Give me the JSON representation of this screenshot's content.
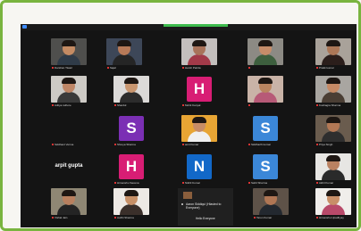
{
  "tiles": {
    "r0": [
      {
        "name": "Darshan Tiwari",
        "type": "video",
        "bg": "#4f4f4d",
        "skin": "#c48b63",
        "shirt": "#2f3b48"
      },
      {
        "name": "Sajal",
        "type": "video",
        "bg": "#3d4758",
        "skin": "#b77a58",
        "shirt": "#252525"
      },
      {
        "name": "Harsh Parida",
        "type": "video",
        "bg": "#c3bfbd",
        "skin": "#a8735a",
        "shirt": "#a23a49"
      },
      {
        "name": "",
        "type": "video",
        "bg": "#8c8a84",
        "skin": "#c58c69",
        "shirt": "#3d5f3e"
      },
      {
        "name": "Pratik kumar",
        "type": "video",
        "bg": "#a9a29a",
        "skin": "#ac7757",
        "shirt": "#2b1e1b"
      }
    ],
    "r1": [
      {
        "name": "Aditya rathore",
        "type": "video",
        "bg": "#cdcac5",
        "skin": "#bf8666",
        "shirt": "#3a3a3a"
      },
      {
        "name": "Shardul",
        "type": "video",
        "bg": "#dcdad8",
        "skin": "#c9966f",
        "shirt": "#2c2c2c"
      },
      {
        "name": "Mohit Kanyal",
        "type": "avatar",
        "letter": "H",
        "color": "#d81d74"
      },
      {
        "name": "",
        "type": "video",
        "bg": "#c9b3a7",
        "skin": "#ba8560",
        "shirt": "#b75a77"
      },
      {
        "name": "Kushagra Sharma",
        "type": "video",
        "bg": "#a9a6a1",
        "skin": "#c68a65",
        "shirt": "#4a3e34"
      }
    ],
    "r2": [
      {
        "name": "Siddhant Verma",
        "type": "empty"
      },
      {
        "name": "Shreya Sharma",
        "type": "avatar",
        "letter": "S",
        "color": "#7b2fb4"
      },
      {
        "name": "amit Kumar",
        "type": "video",
        "bg": "#e8a534",
        "skin": "#c78c66",
        "shirt": "#f0f0f0"
      },
      {
        "name": "Siddharth kumar",
        "type": "avatar",
        "letter": "S",
        "color": "#3b87d8"
      },
      {
        "name": "Priya Singh",
        "type": "video",
        "bg": "#6a5c4e",
        "skin": "#b37855",
        "shirt": "#2e2e2e"
      }
    ],
    "r3": [
      {
        "name": "arpit gupta",
        "type": "text"
      },
      {
        "name": "Himanshu Saxena",
        "type": "avatar",
        "letter": "H",
        "color": "#d81d74"
      },
      {
        "name": "Nikhil Kumar",
        "type": "avatar",
        "letter": "N",
        "color": "#1268c8"
      },
      {
        "name": "Sahil Sharma",
        "type": "avatar",
        "letter": "S",
        "color": "#3b87d8"
      },
      {
        "name": "Akhil Kumar",
        "type": "video",
        "bg": "#e7e6e3",
        "skin": "#b98161",
        "shirt": "#2a2a2a"
      }
    ],
    "r4": [
      {
        "name": "Vishal Jain",
        "type": "video",
        "bg": "#8f8774",
        "skin": "#b8805f",
        "shirt": "#242424"
      },
      {
        "name": "Avdhi Sharma",
        "type": "video",
        "bg": "#ede9e4",
        "skin": "#c79067",
        "shirt": "#3a2f2a"
      },
      {
        "name": "Tarun Kumar",
        "type": "video",
        "bg": "#5e5248",
        "skin": "#b07654",
        "shirt": "#23282f"
      },
      {
        "name": "Himanshu Upadhyay",
        "type": "video",
        "bg": "#f0eeeb",
        "skin": "#c88f68",
        "shirt": "#b84a6a"
      }
    ]
  },
  "chat": {
    "message": "Aaron Siddiqui (Hlasted to Everyone)",
    "button": "Hello Everyone"
  }
}
